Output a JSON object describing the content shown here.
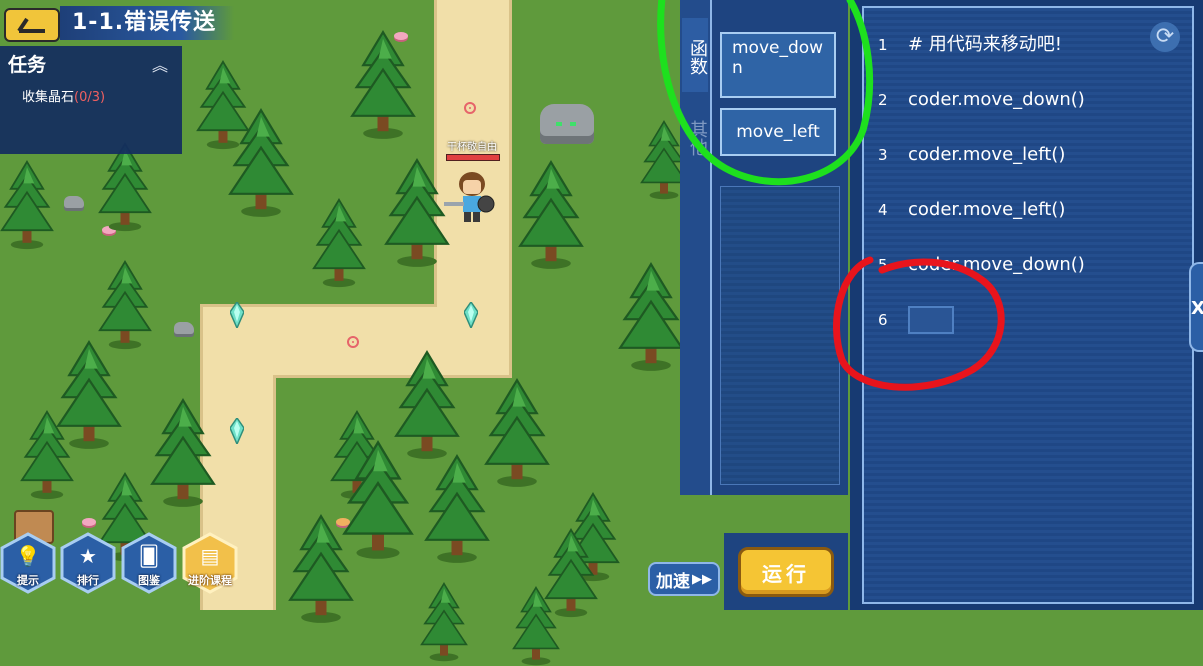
{
  "header": {
    "back_icon": "back-arrow-icon",
    "level_title": "1-1.错误传送"
  },
  "task_panel": {
    "title": "任务",
    "collapse_icon": "chevron-up-icon",
    "item_label": "收集晶石",
    "item_progress": "(0/3)"
  },
  "player": {
    "name": "干杯敬自由"
  },
  "bottom_bar": {
    "buttons": [
      {
        "label": "提示",
        "icon": "lightbulb-icon"
      },
      {
        "label": "排行",
        "icon": "star-icon"
      },
      {
        "label": "图鉴",
        "icon": "cards-icon"
      },
      {
        "label": "进阶课程",
        "icon": "course-book-icon"
      }
    ],
    "speed_label": "加速",
    "speed_icon": "fast-forward-icon",
    "run_label": "运行"
  },
  "palette": {
    "tabs": [
      "函数",
      "其他"
    ],
    "active_tab": "函数",
    "functions": [
      "move_down",
      "move_left"
    ]
  },
  "editor": {
    "refresh_icon": "refresh-icon",
    "lines": [
      {
        "no": "1",
        "code": "# 用代码来移动吧!"
      },
      {
        "no": "2",
        "code": "coder.move_down()"
      },
      {
        "no": "3",
        "code": "coder.move_left()"
      },
      {
        "no": "4",
        "code": "coder.move_left()"
      },
      {
        "no": "5",
        "code": "coder.move_down()"
      },
      {
        "no": "6",
        "code": ""
      }
    ],
    "side_handle": "X"
  },
  "colors": {
    "grass": "#5f9a3c",
    "path": "#f1dfa9",
    "panel_blue": "#1e4480",
    "run_button": "#f5c534",
    "green_annotation": "#1ee01e",
    "red_annotation": "#e8141c"
  }
}
